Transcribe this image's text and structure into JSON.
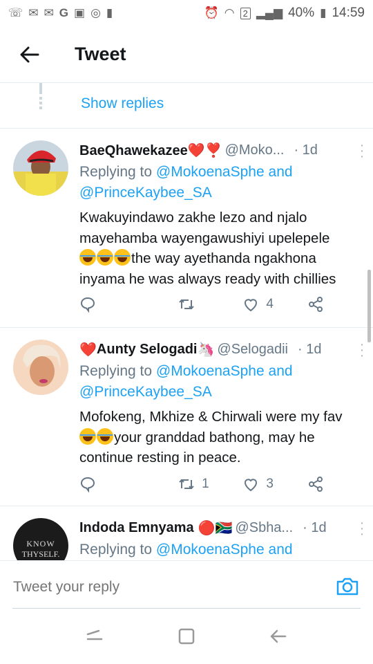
{
  "status_bar": {
    "battery": "40%",
    "time": "14:59",
    "sim": "2"
  },
  "header": {
    "title": "Tweet"
  },
  "thread": {
    "show_replies": "Show replies"
  },
  "tweets": [
    {
      "name": "BaeQhawekazee❤️❣️",
      "handle": "@Moko...",
      "time": "· 1d",
      "replying_prefix": "Replying to",
      "replying_1": "@MokoenaSphe",
      "replying_and": "and",
      "replying_2": "@PrinceKaybee_SA",
      "text_1": "Kwakuyindawo zakhe lezo and njalo mayehamba wayengawushiyi upelepele",
      "text_2": "the way ayethanda ngakhona inyama he was always ready with chillies",
      "reply_count": "",
      "retweet_count": "",
      "like_count": "4"
    },
    {
      "name": "Aunty Selogadi",
      "name_prefix": "❤️",
      "name_suffix": "🦄",
      "handle": "@Selogadii",
      "time": "· 1d",
      "replying_prefix": "Replying to",
      "replying_1": "@MokoenaSphe",
      "replying_and": "and",
      "replying_2": "@PrinceKaybee_SA",
      "text_1": "Mofokeng, Mkhize & Chirwali were my fav",
      "text_2": "your granddad bathong, may he continue resting in peace.",
      "reply_count": "",
      "retweet_count": "1",
      "like_count": "3"
    },
    {
      "name": "Indoda Emnyama",
      "name_suffix": "🔴🇿🇦",
      "handle": "@Sbha...",
      "time": "· 1d",
      "replying_prefix": "Replying to",
      "replying_1": "@MokoenaSphe",
      "replying_and": "and",
      "avatar_text_1": "KNOW",
      "avatar_text_2": "THYSELF."
    }
  ],
  "reply_bar": {
    "placeholder": "Tweet your reply"
  },
  "colors": {
    "accent": "#1da1f2",
    "secondary_text": "#657786",
    "divider": "#e6ecf0"
  }
}
